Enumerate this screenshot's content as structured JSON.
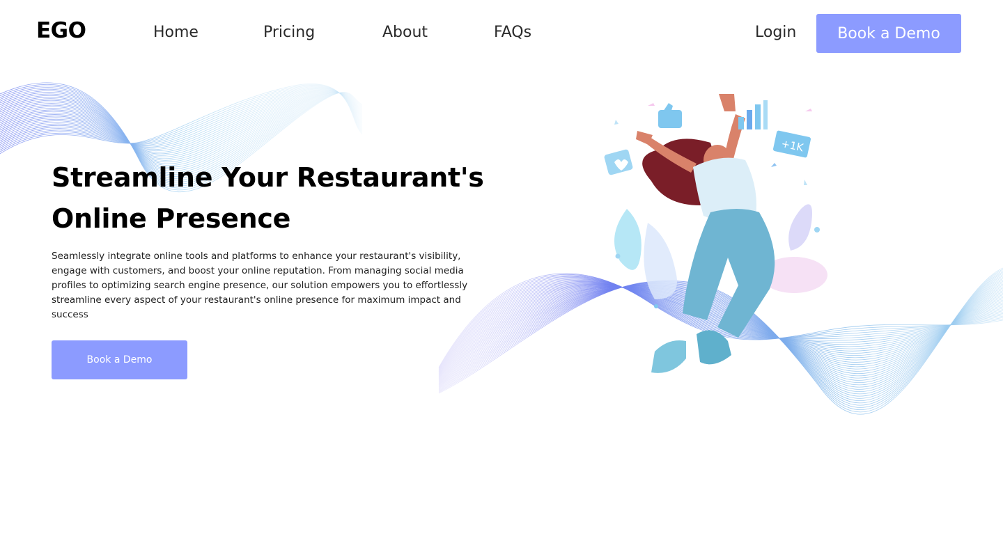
{
  "header": {
    "logo": "EGO",
    "nav": [
      "Home",
      "Pricing",
      "About",
      "FAQs"
    ],
    "login": "Login",
    "cta": "Book a Demo"
  },
  "hero": {
    "title": "Streamline Your Restaurant's Online Presence",
    "description": "Seamlessly integrate online tools and platforms to enhance your restaurant's visibility, engage with customers, and boost your online reputation. From managing social media profiles to optimizing search engine presence, our solution empowers you to effortlessly streamline every aspect of your restaurant's online presence for maximum impact and success",
    "cta": "Book a Demo",
    "badge": "+1K"
  },
  "icons": [
    "thumbs-up-icon",
    "heart-icon",
    "bar-chart-icon"
  ],
  "colors": {
    "accent": "#8c9bff",
    "wave_light": "#a8d4f2",
    "wave_dark": "#6b7fe0"
  }
}
